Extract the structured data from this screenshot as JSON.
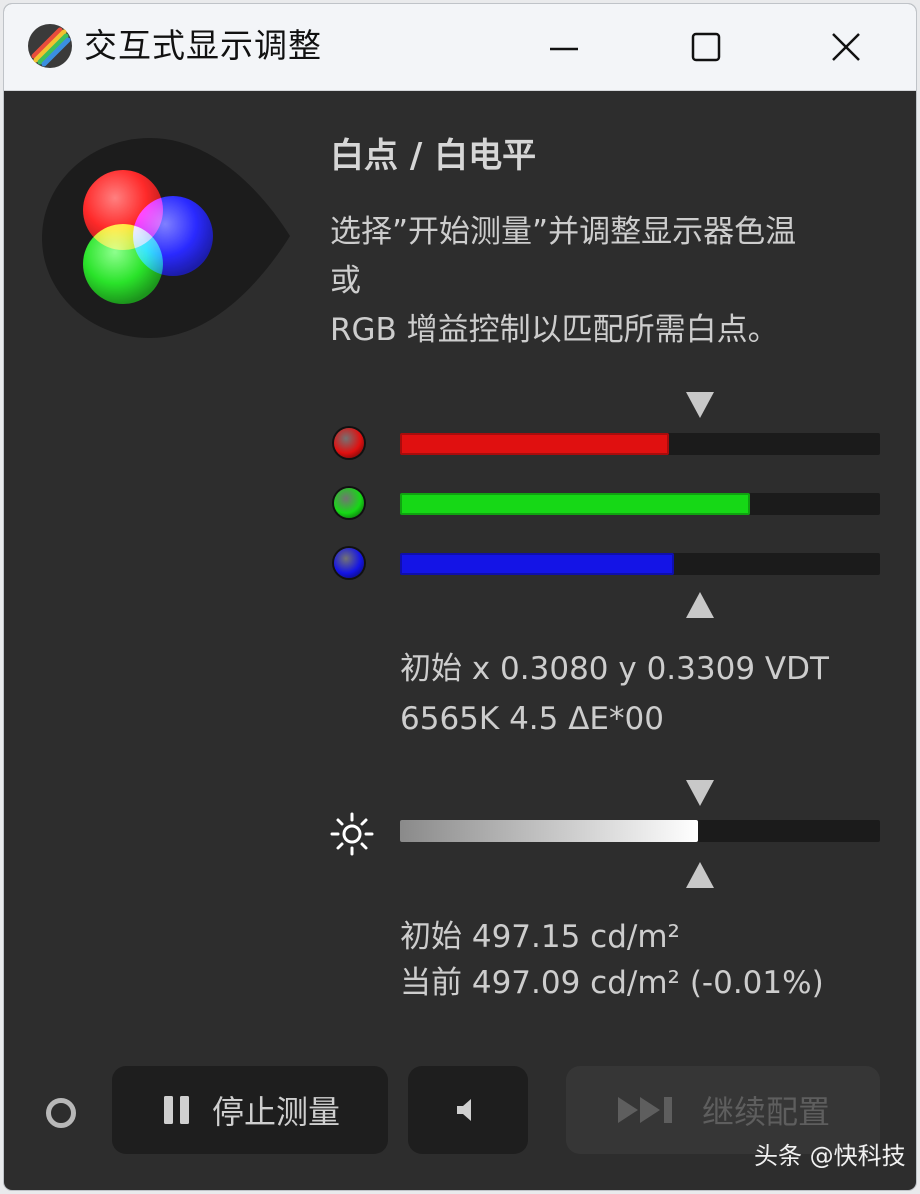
{
  "window": {
    "title": "交互式显示调整"
  },
  "section": {
    "heading": "白点 / 白电平",
    "description_lines": [
      "选择”开始测量”并调整显示器色温",
      "或",
      "RGB 增益控制以匹配所需白点。"
    ]
  },
  "rgb_gains": [
    {
      "channel": "red",
      "icon": "red-dot-icon",
      "color": "#e01010",
      "level": 0.56
    },
    {
      "channel": "green",
      "icon": "green-dot-icon",
      "color": "#16d816",
      "level": 0.73
    },
    {
      "channel": "blue",
      "icon": "blue-dot-icon",
      "color": "#1414e6",
      "level": 0.57
    }
  ],
  "color_readout": {
    "line1": "初始 x 0.3080 y 0.3309 VDT",
    "line2": "6565K 4.5 ΔE*00"
  },
  "luminance": {
    "icon": "sun-icon",
    "level": 0.62
  },
  "luminance_readout": {
    "line1": "初始 497.15 cd/m²",
    "line2": "当前 497.09 cd/m² (-0.01%)"
  },
  "buttons": {
    "stop_label": "停止测量",
    "continue_label": "继续配置"
  },
  "watermark": "头条 @快科技",
  "colors": {
    "window_bg": "#2d2d2d",
    "titlebar_bg": "#f3f5f8",
    "track_bg": "#1b1b1b"
  }
}
